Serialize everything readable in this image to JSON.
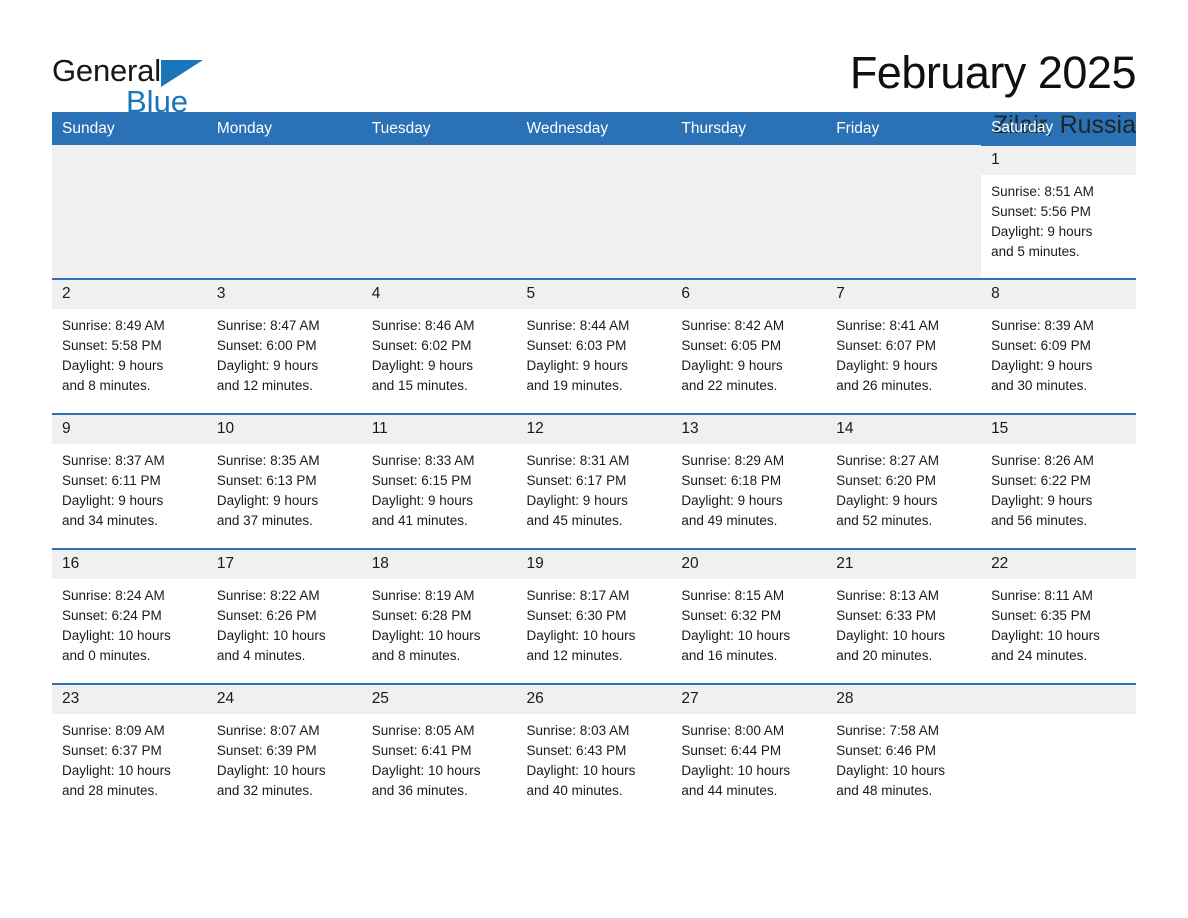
{
  "brand": {
    "name_part1": "General",
    "name_part2": "Blue",
    "accent_color": "#1a75bb"
  },
  "header": {
    "month_title": "February 2025",
    "location": "Zilair, Russia"
  },
  "theme": {
    "header_blue": "#2a72b5",
    "daynum_band": "#f0f0f0",
    "text": "#1a1a1a"
  },
  "weekday_headers": [
    "Sunday",
    "Monday",
    "Tuesday",
    "Wednesday",
    "Thursday",
    "Friday",
    "Saturday"
  ],
  "weeks": [
    [
      {
        "day": "",
        "blank": true
      },
      {
        "day": "",
        "blank": true
      },
      {
        "day": "",
        "blank": true
      },
      {
        "day": "",
        "blank": true
      },
      {
        "day": "",
        "blank": true
      },
      {
        "day": "",
        "blank": true
      },
      {
        "day": "1",
        "sunrise": "Sunrise: 8:51 AM",
        "sunset": "Sunset: 5:56 PM",
        "daylight_line1": "Daylight: 9 hours",
        "daylight_line2": "and 5 minutes."
      }
    ],
    [
      {
        "day": "2",
        "sunrise": "Sunrise: 8:49 AM",
        "sunset": "Sunset: 5:58 PM",
        "daylight_line1": "Daylight: 9 hours",
        "daylight_line2": "and 8 minutes."
      },
      {
        "day": "3",
        "sunrise": "Sunrise: 8:47 AM",
        "sunset": "Sunset: 6:00 PM",
        "daylight_line1": "Daylight: 9 hours",
        "daylight_line2": "and 12 minutes."
      },
      {
        "day": "4",
        "sunrise": "Sunrise: 8:46 AM",
        "sunset": "Sunset: 6:02 PM",
        "daylight_line1": "Daylight: 9 hours",
        "daylight_line2": "and 15 minutes."
      },
      {
        "day": "5",
        "sunrise": "Sunrise: 8:44 AM",
        "sunset": "Sunset: 6:03 PM",
        "daylight_line1": "Daylight: 9 hours",
        "daylight_line2": "and 19 minutes."
      },
      {
        "day": "6",
        "sunrise": "Sunrise: 8:42 AM",
        "sunset": "Sunset: 6:05 PM",
        "daylight_line1": "Daylight: 9 hours",
        "daylight_line2": "and 22 minutes."
      },
      {
        "day": "7",
        "sunrise": "Sunrise: 8:41 AM",
        "sunset": "Sunset: 6:07 PM",
        "daylight_line1": "Daylight: 9 hours",
        "daylight_line2": "and 26 minutes."
      },
      {
        "day": "8",
        "sunrise": "Sunrise: 8:39 AM",
        "sunset": "Sunset: 6:09 PM",
        "daylight_line1": "Daylight: 9 hours",
        "daylight_line2": "and 30 minutes."
      }
    ],
    [
      {
        "day": "9",
        "sunrise": "Sunrise: 8:37 AM",
        "sunset": "Sunset: 6:11 PM",
        "daylight_line1": "Daylight: 9 hours",
        "daylight_line2": "and 34 minutes."
      },
      {
        "day": "10",
        "sunrise": "Sunrise: 8:35 AM",
        "sunset": "Sunset: 6:13 PM",
        "daylight_line1": "Daylight: 9 hours",
        "daylight_line2": "and 37 minutes."
      },
      {
        "day": "11",
        "sunrise": "Sunrise: 8:33 AM",
        "sunset": "Sunset: 6:15 PM",
        "daylight_line1": "Daylight: 9 hours",
        "daylight_line2": "and 41 minutes."
      },
      {
        "day": "12",
        "sunrise": "Sunrise: 8:31 AM",
        "sunset": "Sunset: 6:17 PM",
        "daylight_line1": "Daylight: 9 hours",
        "daylight_line2": "and 45 minutes."
      },
      {
        "day": "13",
        "sunrise": "Sunrise: 8:29 AM",
        "sunset": "Sunset: 6:18 PM",
        "daylight_line1": "Daylight: 9 hours",
        "daylight_line2": "and 49 minutes."
      },
      {
        "day": "14",
        "sunrise": "Sunrise: 8:27 AM",
        "sunset": "Sunset: 6:20 PM",
        "daylight_line1": "Daylight: 9 hours",
        "daylight_line2": "and 52 minutes."
      },
      {
        "day": "15",
        "sunrise": "Sunrise: 8:26 AM",
        "sunset": "Sunset: 6:22 PM",
        "daylight_line1": "Daylight: 9 hours",
        "daylight_line2": "and 56 minutes."
      }
    ],
    [
      {
        "day": "16",
        "sunrise": "Sunrise: 8:24 AM",
        "sunset": "Sunset: 6:24 PM",
        "daylight_line1": "Daylight: 10 hours",
        "daylight_line2": "and 0 minutes."
      },
      {
        "day": "17",
        "sunrise": "Sunrise: 8:22 AM",
        "sunset": "Sunset: 6:26 PM",
        "daylight_line1": "Daylight: 10 hours",
        "daylight_line2": "and 4 minutes."
      },
      {
        "day": "18",
        "sunrise": "Sunrise: 8:19 AM",
        "sunset": "Sunset: 6:28 PM",
        "daylight_line1": "Daylight: 10 hours",
        "daylight_line2": "and 8 minutes."
      },
      {
        "day": "19",
        "sunrise": "Sunrise: 8:17 AM",
        "sunset": "Sunset: 6:30 PM",
        "daylight_line1": "Daylight: 10 hours",
        "daylight_line2": "and 12 minutes."
      },
      {
        "day": "20",
        "sunrise": "Sunrise: 8:15 AM",
        "sunset": "Sunset: 6:32 PM",
        "daylight_line1": "Daylight: 10 hours",
        "daylight_line2": "and 16 minutes."
      },
      {
        "day": "21",
        "sunrise": "Sunrise: 8:13 AM",
        "sunset": "Sunset: 6:33 PM",
        "daylight_line1": "Daylight: 10 hours",
        "daylight_line2": "and 20 minutes."
      },
      {
        "day": "22",
        "sunrise": "Sunrise: 8:11 AM",
        "sunset": "Sunset: 6:35 PM",
        "daylight_line1": "Daylight: 10 hours",
        "daylight_line2": "and 24 minutes."
      }
    ],
    [
      {
        "day": "23",
        "sunrise": "Sunrise: 8:09 AM",
        "sunset": "Sunset: 6:37 PM",
        "daylight_line1": "Daylight: 10 hours",
        "daylight_line2": "and 28 minutes."
      },
      {
        "day": "24",
        "sunrise": "Sunrise: 8:07 AM",
        "sunset": "Sunset: 6:39 PM",
        "daylight_line1": "Daylight: 10 hours",
        "daylight_line2": "and 32 minutes."
      },
      {
        "day": "25",
        "sunrise": "Sunrise: 8:05 AM",
        "sunset": "Sunset: 6:41 PM",
        "daylight_line1": "Daylight: 10 hours",
        "daylight_line2": "and 36 minutes."
      },
      {
        "day": "26",
        "sunrise": "Sunrise: 8:03 AM",
        "sunset": "Sunset: 6:43 PM",
        "daylight_line1": "Daylight: 10 hours",
        "daylight_line2": "and 40 minutes."
      },
      {
        "day": "27",
        "sunrise": "Sunrise: 8:00 AM",
        "sunset": "Sunset: 6:44 PM",
        "daylight_line1": "Daylight: 10 hours",
        "daylight_line2": "and 44 minutes."
      },
      {
        "day": "28",
        "sunrise": "Sunrise: 7:58 AM",
        "sunset": "Sunset: 6:46 PM",
        "daylight_line1": "Daylight: 10 hours",
        "daylight_line2": "and 48 minutes."
      },
      {
        "day": "",
        "blank": true
      }
    ]
  ]
}
